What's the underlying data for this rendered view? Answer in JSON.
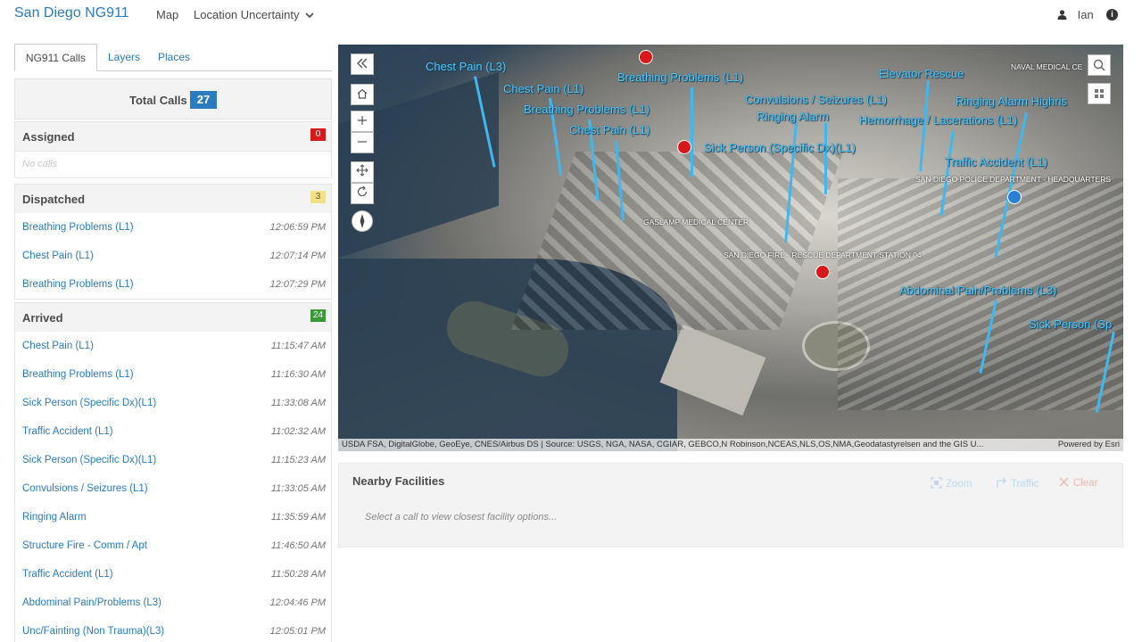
{
  "app": {
    "title": "San Diego NG911"
  },
  "nav": {
    "map": "Map",
    "location_uncertainty": "Location Uncertainty"
  },
  "user": {
    "name": "Ian"
  },
  "tabs": [
    {
      "label": "NG911 Calls"
    },
    {
      "label": "Layers"
    },
    {
      "label": "Places"
    }
  ],
  "total": {
    "label": "Total Calls",
    "count": "27"
  },
  "sections": {
    "assigned": {
      "label": "Assigned",
      "count": "0",
      "color": "#d7191c",
      "empty": "No calls"
    },
    "dispatched": {
      "label": "Dispatched",
      "count": "3",
      "color": "#f0e08a",
      "rows": [
        {
          "name": "Breathing Problems (L1)",
          "time": "12:06:59 PM"
        },
        {
          "name": "Chest Pain (L1)",
          "time": "12:07:14 PM"
        },
        {
          "name": "Breathing Problems (L1)",
          "time": "12:07:29 PM"
        }
      ]
    },
    "arrived": {
      "label": "Arrived",
      "count": "24",
      "color": "#3a9a3a",
      "rows": [
        {
          "name": "Chest Pain (L1)",
          "time": "11:15:47 AM"
        },
        {
          "name": "Breathing Problems (L1)",
          "time": "11:16:30 AM"
        },
        {
          "name": "Sick Person (Specific Dx)(L1)",
          "time": "11:33:08 AM"
        },
        {
          "name": "Traffic Accident (L1)",
          "time": "11:02:32 AM"
        },
        {
          "name": "Sick Person (Specific Dx)(L1)",
          "time": "11:15:23 AM"
        },
        {
          "name": "Convulsions / Seizures (L1)",
          "time": "11:33:05 AM"
        },
        {
          "name": "Ringing Alarm",
          "time": "11:35:59 AM"
        },
        {
          "name": "Structure Fire - Comm / Apt",
          "time": "11:46:50 AM"
        },
        {
          "name": "Traffic Accident (L1)",
          "time": "11:50:28 AM"
        },
        {
          "name": "Abdominal Pain/Problems (L3)",
          "time": "12:04:46 PM"
        },
        {
          "name": "Unc/Fainting (Non Trauma)(L3)",
          "time": "12:05:01 PM"
        }
      ]
    }
  },
  "map": {
    "labels": [
      "Chest Pain (L3)",
      "Breathing Problems (L1)",
      "Chest Pain (L1)",
      "Breathing Problems (L1)",
      "Chest Pain (L1)",
      "Sick Person (Specific Dx)(L1)",
      "Convulsions / Seizures (L1)",
      "Ringing Alarm",
      "Elevator Rescue",
      "Ringing Alarm Highris",
      "Hemorrhage / Lacerations (L1)",
      "Traffic Accident (L1)",
      "Abdominal Pain/Problems (L3)",
      "Sick Person (Sp"
    ],
    "places": [
      "NAVAL MEDICAL CE",
      "SAN DIEGO POLICE DEPARTMENT - HEADQUARTERS",
      "GASLAMP MEDICAL CENTER",
      "SAN DIEGO FIRE - RESCUE DEPARTMENT STATION 04"
    ],
    "attribution": "USDA FSA, DigitalGlobe, GeoEye, CNES/Airbus DS | Source: USGS, NGA, NASA, CGIAR, GEBCO,N Robinson,NCEAS,NLS,OS,NMA,Geodatastyrelsen and the GIS U...",
    "powered_by": "Powered by Esri"
  },
  "nearby": {
    "title": "Nearby Facilities",
    "hint": "Select a call to view closest facility options...",
    "zoom": "Zoom",
    "traffic": "Traffic",
    "clear": "Clear"
  },
  "colors": {
    "accent": "#2b7bbf",
    "map_label": "#58c8f5"
  }
}
